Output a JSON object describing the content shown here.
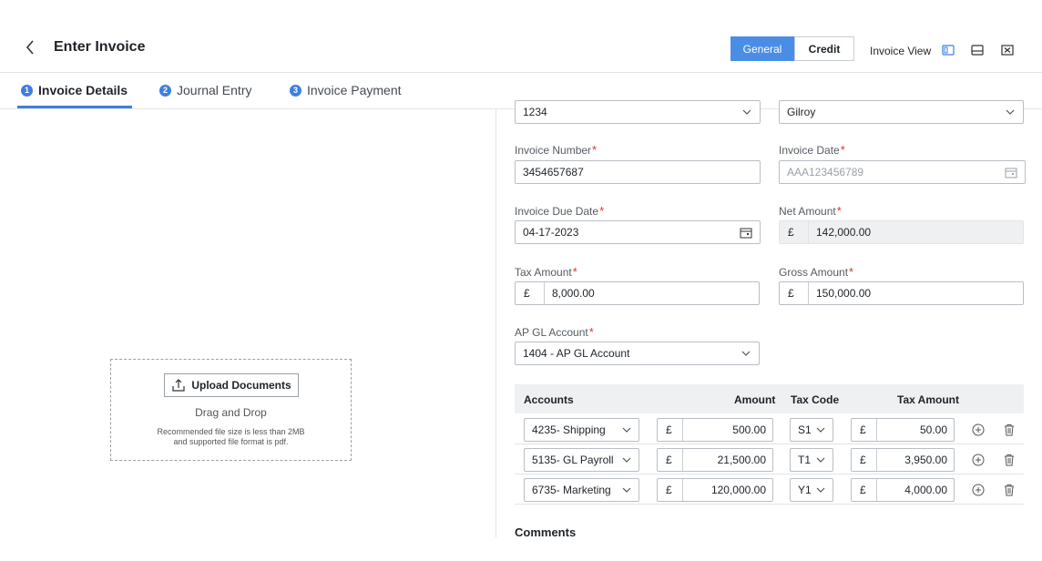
{
  "header": {
    "title": "Enter Invoice",
    "toggle": {
      "general": "General",
      "credit": "Credit",
      "selected": "General"
    },
    "invoice_view_label": "Invoice View"
  },
  "tabs": [
    {
      "num": "1",
      "label": "Invoice Details",
      "active": true
    },
    {
      "num": "2",
      "label": "Journal Entry",
      "active": false
    },
    {
      "num": "3",
      "label": "Invoice Payment",
      "active": false
    }
  ],
  "upload": {
    "button_label": "Upload Documents",
    "drag_drop": "Drag and Drop",
    "recommendation_line1": "Recommended file size is less than 2MB",
    "recommendation_line2": "and supported file format is pdf."
  },
  "form": {
    "top_left_value": "1234",
    "top_right_value": "Gilroy",
    "invoice_number": {
      "label": "Invoice Number",
      "value": "3454657687"
    },
    "invoice_date": {
      "label": "Invoice Date",
      "placeholder": "AAA123456789"
    },
    "invoice_due_date": {
      "label": "Invoice Due Date",
      "value": "04-17-2023"
    },
    "net_amount": {
      "label": "Net Amount",
      "currency": "£",
      "value": "142,000.00"
    },
    "tax_amount": {
      "label": "Tax Amount",
      "currency": "£",
      "value": "8,000.00"
    },
    "gross_amount": {
      "label": "Gross Amount",
      "currency": "£",
      "value": "150,000.00"
    },
    "ap_gl_account": {
      "label": "AP GL Account",
      "value": "1404 - AP GL Account"
    },
    "required_mark": "*"
  },
  "table": {
    "headers": {
      "accounts": "Accounts",
      "amount": "Amount",
      "tax_code": "Tax Code",
      "tax_amount": "Tax Amount"
    },
    "rows": [
      {
        "account": "4235- Shipping",
        "currency": "£",
        "amount": "500.00",
        "tax_code": "S1",
        "tax_currency": "£",
        "tax_amount": "50.00"
      },
      {
        "account": "5135- GL Payroll",
        "currency": "£",
        "amount": "21,500.00",
        "tax_code": "T1",
        "tax_currency": "£",
        "tax_amount": "3,950.00"
      },
      {
        "account": "6735- Marketing",
        "currency": "£",
        "amount": "120,000.00",
        "tax_code": "Y1",
        "tax_currency": "£",
        "tax_amount": "4,000.00"
      }
    ]
  },
  "comments_label": "Comments",
  "colors": {
    "accent": "#3d7fe0",
    "toggle_active": "#4a8de6",
    "required": "#e0312a"
  },
  "icons": [
    "chevron-left-icon",
    "split-view-icon",
    "horizontal-split-icon",
    "close-box-icon",
    "upload-icon",
    "chevron-down-icon",
    "calendar-icon",
    "add-circle-icon",
    "trash-icon"
  ]
}
